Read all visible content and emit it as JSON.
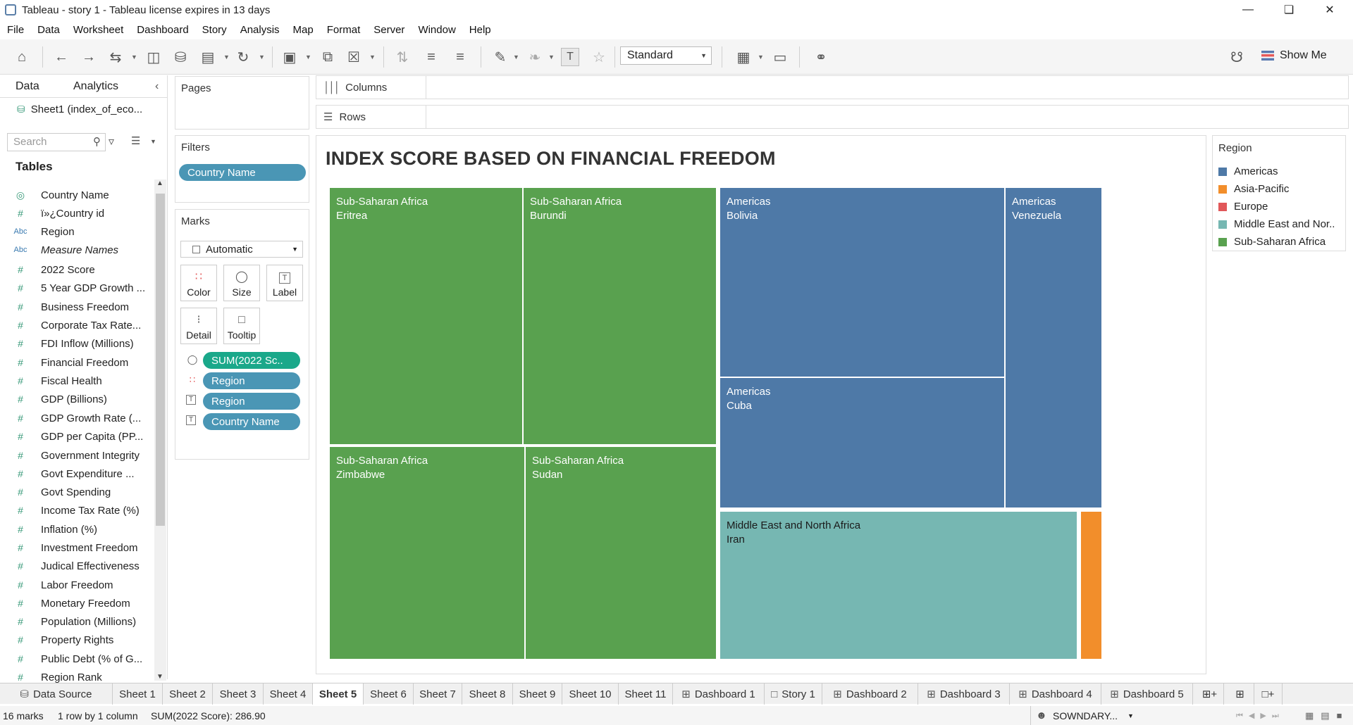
{
  "window": {
    "title": "Tableau - story 1 - Tableau license expires in 13 days"
  },
  "menu": [
    "File",
    "Data",
    "Worksheet",
    "Dashboard",
    "Story",
    "Analysis",
    "Map",
    "Format",
    "Server",
    "Window",
    "Help"
  ],
  "toolbar": {
    "fit": "Standard",
    "show_me": "Show Me"
  },
  "data_pane": {
    "tab_data": "Data",
    "tab_analytics": "Analytics",
    "datasource": "Sheet1 (index_of_eco...",
    "search_placeholder": "Search",
    "tables_heading": "Tables",
    "fields": [
      {
        "type": "geo",
        "name": "Country Name"
      },
      {
        "type": "num",
        "name": "ï»¿Country id"
      },
      {
        "type": "abc",
        "name": "Region"
      },
      {
        "type": "abc",
        "name": "Measure Names",
        "italic": true
      },
      {
        "type": "num",
        "name": "2022 Score"
      },
      {
        "type": "num",
        "name": "5 Year GDP Growth ..."
      },
      {
        "type": "num",
        "name": "Business Freedom"
      },
      {
        "type": "num",
        "name": "Corporate Tax Rate..."
      },
      {
        "type": "num",
        "name": "FDI Inflow (Millions)"
      },
      {
        "type": "num",
        "name": "Financial Freedom"
      },
      {
        "type": "num",
        "name": "Fiscal Health"
      },
      {
        "type": "num",
        "name": "GDP (Billions)"
      },
      {
        "type": "num",
        "name": "GDP Growth Rate (..."
      },
      {
        "type": "num",
        "name": "GDP per Capita (PP..."
      },
      {
        "type": "num",
        "name": "Government Integrity"
      },
      {
        "type": "num",
        "name": "Govt Expenditure ..."
      },
      {
        "type": "num",
        "name": "Govt Spending"
      },
      {
        "type": "num",
        "name": "Income Tax Rate (%)"
      },
      {
        "type": "num",
        "name": "Inflation (%)"
      },
      {
        "type": "num",
        "name": "Investment Freedom"
      },
      {
        "type": "num",
        "name": "Judical Effectiveness"
      },
      {
        "type": "num",
        "name": "Labor Freedom"
      },
      {
        "type": "num",
        "name": "Monetary Freedom"
      },
      {
        "type": "num",
        "name": "Population (Millions)"
      },
      {
        "type": "num",
        "name": "Property Rights"
      },
      {
        "type": "num",
        "name": "Public Debt (% of G..."
      },
      {
        "type": "num",
        "name": "Region Rank"
      }
    ]
  },
  "pages_card": {
    "title": "Pages"
  },
  "filters_card": {
    "title": "Filters",
    "pill": "Country Name"
  },
  "marks_card": {
    "title": "Marks",
    "mark_type": "Automatic",
    "buttons": [
      "Color",
      "Size",
      "Label",
      "Detail",
      "Tooltip"
    ],
    "pills": [
      {
        "icon": "size-icon",
        "label": "SUM(2022 Sc..",
        "kind": "green"
      },
      {
        "icon": "color-icon",
        "label": "Region",
        "kind": "blue"
      },
      {
        "icon": "label-icon",
        "label": "Region",
        "kind": "blue"
      },
      {
        "icon": "label-icon",
        "label": "Country Name",
        "kind": "blue"
      }
    ]
  },
  "shelves": {
    "columns": "Columns",
    "rows": "Rows"
  },
  "view": {
    "title": "INDEX SCORE BASED ON FINANCIAL FREEDOM"
  },
  "legend": {
    "title": "Region",
    "items": [
      {
        "label": "Americas",
        "color": "#4e79a7"
      },
      {
        "label": "Asia-Pacific",
        "color": "#f28e2b"
      },
      {
        "label": "Europe",
        "color": "#e15759"
      },
      {
        "label": "Middle East and Nor..",
        "color": "#76b7b2"
      },
      {
        "label": "Sub-Saharan Africa",
        "color": "#59a14f"
      }
    ]
  },
  "chart_data": {
    "type": "treemap",
    "title": "INDEX SCORE BASED ON FINANCIAL FREEDOM",
    "size_measure": "SUM(2022 Score)",
    "total": 286.9,
    "marks_count": 16,
    "tiles": [
      {
        "region": "Sub-Saharan Africa",
        "country": "Eritrea",
        "labeled": true
      },
      {
        "region": "Sub-Saharan Africa",
        "country": "Burundi",
        "labeled": true
      },
      {
        "region": "Sub-Saharan Africa",
        "country": "Zimbabwe",
        "labeled": true
      },
      {
        "region": "Sub-Saharan Africa",
        "country": "Sudan",
        "labeled": true
      },
      {
        "region": "Americas",
        "country": "Bolivia",
        "labeled": true
      },
      {
        "region": "Americas",
        "country": "Cuba",
        "labeled": true
      },
      {
        "region": "Americas",
        "country": "Venezuela",
        "labeled": true
      },
      {
        "region": "Middle East and North Africa",
        "country": "Iran",
        "labeled": true
      },
      {
        "region": "Asia-Pacific",
        "country": "",
        "labeled": false
      }
    ]
  },
  "sheet_tabs": [
    {
      "label": "Data Source",
      "icon": "database-icon"
    },
    {
      "label": "Sheet 1"
    },
    {
      "label": "Sheet 2"
    },
    {
      "label": "Sheet 3"
    },
    {
      "label": "Sheet 4"
    },
    {
      "label": "Sheet 5",
      "active": true
    },
    {
      "label": "Sheet 6"
    },
    {
      "label": "Sheet 7"
    },
    {
      "label": "Sheet 8"
    },
    {
      "label": "Sheet 9"
    },
    {
      "label": "Sheet 10"
    },
    {
      "label": "Sheet 11"
    },
    {
      "label": "Dashboard 1",
      "icon": "dashboard-icon"
    },
    {
      "label": "Story 1",
      "icon": "story-icon"
    },
    {
      "label": "Dashboard 2",
      "icon": "dashboard-icon"
    },
    {
      "label": "Dashboard 3",
      "icon": "dashboard-icon"
    },
    {
      "label": "Dashboard 4",
      "icon": "dashboard-icon"
    },
    {
      "label": "Dashboard 5",
      "icon": "dashboard-icon"
    }
  ],
  "status": {
    "marks": "16 marks",
    "rows_cols": "1 row by 1 column",
    "sum": "SUM(2022 Score): 286.90",
    "user": "SOWNDARY..."
  }
}
